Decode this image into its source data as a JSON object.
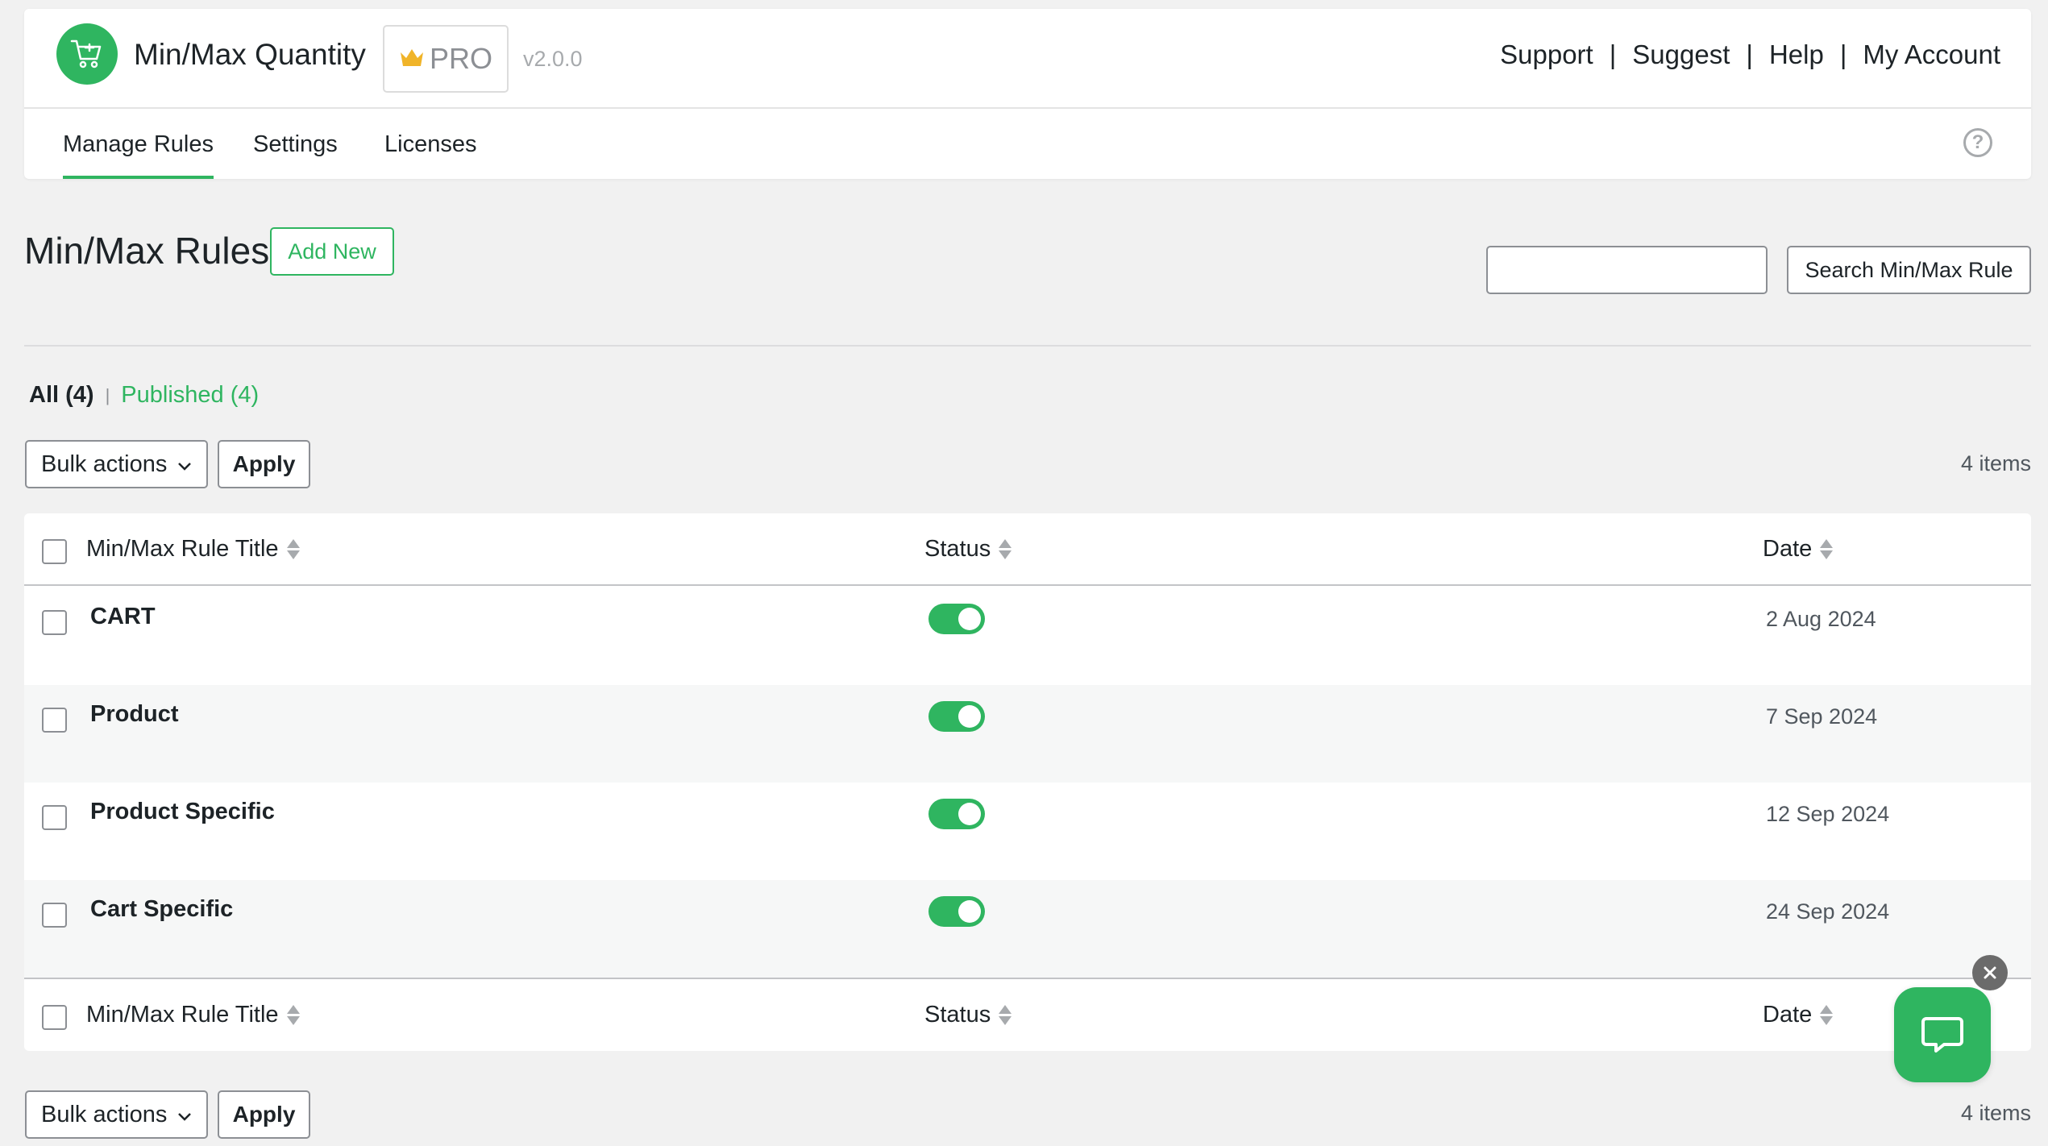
{
  "header": {
    "app_title": "Min/Max Quantity",
    "pro_label": "PRO",
    "version": "v2.0.0",
    "links": [
      "Support",
      "Suggest",
      "Help",
      "My Account"
    ],
    "separator": "|",
    "tabs": [
      {
        "label": "Manage Rules",
        "active": true
      },
      {
        "label": "Settings",
        "active": false
      },
      {
        "label": "Licenses",
        "active": false
      }
    ]
  },
  "page": {
    "title": "Min/Max Rules",
    "add_new_label": "Add New",
    "search_button_label": "Search Min/Max Rule",
    "search_value": ""
  },
  "filters": {
    "all_label": "All (4)",
    "separator": "|",
    "published_label": "Published (4)"
  },
  "bulk": {
    "selected": "Bulk actions",
    "apply_label": "Apply",
    "items_count": "4 items"
  },
  "table": {
    "columns": [
      "Min/Max Rule Title",
      "Status",
      "Date"
    ],
    "rows": [
      {
        "title": "CART",
        "status_on": true,
        "date": "2 Aug 2024"
      },
      {
        "title": "Product",
        "status_on": true,
        "date": "7 Sep 2024"
      },
      {
        "title": "Product Specific",
        "status_on": true,
        "date": "12 Sep 2024"
      },
      {
        "title": "Cart Specific",
        "status_on": true,
        "date": "24 Sep 2024"
      }
    ]
  },
  "colors": {
    "accent": "#2fb560",
    "background": "#f1f1f1",
    "text": "#1d2327",
    "pro_crown": "#f0b429"
  },
  "icons": {
    "logo": "shopping-cart-icon",
    "pro": "crown-icon",
    "help": "question-circle-icon",
    "chat": "chat-bubble-icon",
    "chat_close": "close-icon"
  }
}
